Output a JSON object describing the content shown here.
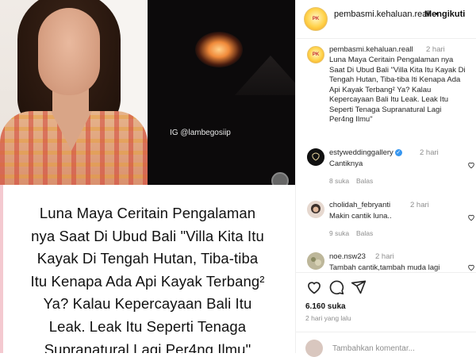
{
  "media": {
    "video_watermark": "IG @lambegosiip",
    "caption_lines": [
      "Luna Maya Ceritain Pengalaman",
      "nya Saat Di Ubud Bali \"Villa Kita Itu",
      "Kayak Di Tengah Hutan, Tiba-tiba",
      "Itu Kenapa Ada Api Kayak Terbang²",
      "Ya? Kalau Kepercayaan Bali Itu",
      "Leak. Leak Itu Seperti Tenaga",
      "Supranatural Lagi Per4ng Ilmu\""
    ]
  },
  "header": {
    "username": "pembasmi.kehaluan.reall",
    "separator": "•",
    "follow_label": "Mengikuti"
  },
  "caption": {
    "username": "pembasmi.kehaluan.reall",
    "time": "2 hari",
    "lines": [
      "Luna Maya Ceritain Pengalaman nya",
      "Saat Di Ubud Bali \"Villa Kita Itu Kayak Di",
      "Tengah Hutan, Tiba-tiba Iti Kenapa Ada",
      "Api Kayak Terbang² Ya? Kalau",
      "Kepercayaan Bali Itu Leak. Leak Itu",
      "Seperti Tenaga Supranatural Lagi",
      "Per4ng Ilmu\""
    ]
  },
  "comments": [
    {
      "username": "estyweddinggallery",
      "verified": true,
      "time": "2 hari",
      "text": "Cantiknya",
      "likes": "8 suka",
      "reply": "Balas"
    },
    {
      "username": "cholidah_febryanti",
      "verified": false,
      "time": "2 hari",
      "text": "Makin cantik luna..",
      "likes": "9 suka",
      "reply": "Balas"
    },
    {
      "username": "noe.nsw23",
      "verified": false,
      "time": "2 hari",
      "text": "Tambah cantik,tambah muda lagi"
    }
  ],
  "footer": {
    "likes": "6.160 suka",
    "posted": "2 hari yang lalu",
    "comment_placeholder": "Tambahkan komentar..."
  },
  "colors": {
    "verified": "#3897f0",
    "muted": "#8e8e8e",
    "text": "#262626"
  }
}
